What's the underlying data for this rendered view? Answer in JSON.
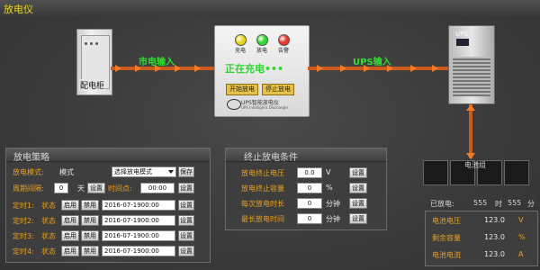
{
  "window": {
    "title": "放电仪"
  },
  "diagram": {
    "cabinet_label": "配电柜",
    "mains_input_label": "市电输入",
    "ups_input_label": "UPS输入",
    "charging_status": "正在充电•••",
    "lamps": [
      {
        "label": "充电",
        "color": "#e8d21c"
      },
      {
        "label": "放电",
        "color": "#2fd82f"
      },
      {
        "label": "告警",
        "color": "#e23a2a"
      }
    ],
    "start_discharge_label": "开始放电",
    "stop_discharge_label": "停止放电",
    "brand_name": "UPS智能放电仪",
    "brand_sub": "UPS Intelligent Discharger",
    "ups_tag": "UPS",
    "battery_label": "电池组"
  },
  "strategy": {
    "title": "放电策略",
    "mode_label": "放电模式:",
    "mode_value": "模式",
    "mode_select": "选择放电模式",
    "save_label": "保存",
    "period_label": "周期间隔:",
    "period_value": "0",
    "period_unit": "天",
    "set_label": "设置",
    "time_point_label": "时间点:",
    "time_point_value": "00:00",
    "timers": [
      {
        "label": "定时1:",
        "state_label": "状态",
        "enable": "启用",
        "disable": "禁用",
        "datetime": "2016-07-1900:00",
        "set": "设置"
      },
      {
        "label": "定时2:",
        "state_label": "状态",
        "enable": "启用",
        "disable": "禁用",
        "datetime": "2016-07-1900:00",
        "set": "设置"
      },
      {
        "label": "定时3:",
        "state_label": "状态",
        "enable": "启用",
        "disable": "禁用",
        "datetime": "2016-07-1900:00",
        "set": "设置"
      },
      {
        "label": "定时4:",
        "state_label": "状态",
        "enable": "启用",
        "disable": "禁用",
        "datetime": "2016-07-1900:00",
        "set": "设置"
      }
    ]
  },
  "stop_conditions": {
    "title": "终止放电条件",
    "rows": [
      {
        "label": "放电终止电压",
        "value": "0.0",
        "unit": "V",
        "button": "设置"
      },
      {
        "label": "放电终止容量",
        "value": "0",
        "unit": "%",
        "button": "设置"
      },
      {
        "label": "每次放电时长",
        "value": "0",
        "unit": "分钟",
        "button": "设置"
      },
      {
        "label": "最长放电时间",
        "value": "0",
        "unit": "分钟",
        "button": "设置"
      }
    ]
  },
  "status": {
    "discharged_label": "已放电:",
    "hours_value": "555",
    "hours_unit": "时",
    "minutes_value": "555",
    "minutes_unit": "分",
    "rows": [
      {
        "label": "电池电压",
        "value": "123.0",
        "unit": "V"
      },
      {
        "label": "剩余容量",
        "value": "123.0",
        "unit": "%"
      },
      {
        "label": "电池电流",
        "value": "123.0",
        "unit": "A"
      }
    ]
  }
}
